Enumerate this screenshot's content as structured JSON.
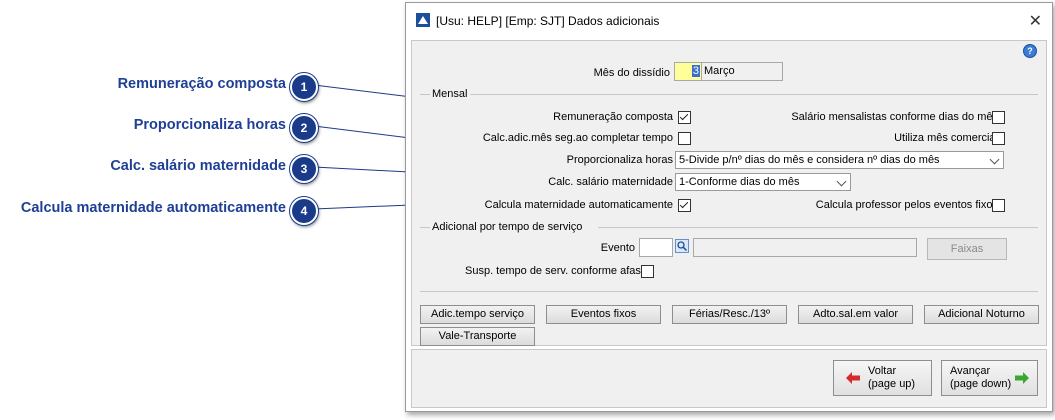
{
  "callouts": [
    {
      "label": "Remuneração composta",
      "number": "1"
    },
    {
      "label": "Proporcionaliza horas",
      "number": "2"
    },
    {
      "label": "Calc. salário maternidade",
      "number": "3"
    },
    {
      "label": "Calcula maternidade automaticamente",
      "number": "4"
    }
  ],
  "window": {
    "title": "[Usu: HELP] [Emp: SJT] Dados adicionais",
    "help_icon": "?"
  },
  "dissidio": {
    "label": "Mês do dissídio",
    "value": "3",
    "month_name": "Março"
  },
  "mensal": {
    "group_label": "Mensal",
    "remuneracao_composta": {
      "label": "Remuneração composta",
      "checked": true
    },
    "calc_adic_mes": {
      "label": "Calc.adic.mês seg.ao completar tempo",
      "checked": false
    },
    "proporcionaliza_horas": {
      "label": "Proporcionaliza horas",
      "value": "5-Divide p/nº dias do mês e considera nº dias do mês"
    },
    "calc_salario_maternidade": {
      "label": "Calc. salário maternidade",
      "value": "1-Conforme dias do mês"
    },
    "calcula_maternidade_auto": {
      "label": "Calcula maternidade automaticamente",
      "checked": true
    },
    "salario_mensalistas": {
      "label": "Salário mensalistas conforme dias do mês",
      "checked": false
    },
    "utiliza_mes_comercial": {
      "label": "Utiliza mês comercial",
      "checked": false
    },
    "calcula_professor": {
      "label": "Calcula professor pelos eventos fixos",
      "checked": false
    }
  },
  "adicional": {
    "group_label": "Adicional por tempo de serviço",
    "evento_label": "Evento",
    "evento_value": "",
    "faixas_button": "Faixas",
    "susp_label": "Susp. tempo de serv. conforme afast.",
    "susp_checked": false
  },
  "buttons": {
    "adic_tempo_servico": "Adic.tempo serviço",
    "eventos_fixos": "Eventos fixos",
    "ferias": "Férias/Resc./13º",
    "adto_sal": "Adto.sal.em valor",
    "adicional_noturno": "Adicional Noturno",
    "vale_transporte": "Vale-Transporte"
  },
  "nav": {
    "voltar": "Voltar",
    "voltar_hint": "(page up)",
    "avancar": "Avançar",
    "avancar_hint": "(page down)"
  },
  "colors": {
    "callout_badge": "#1a3a8a",
    "callout_text": "#1f3f95",
    "highlight_input": "#ffff99",
    "arrow_back": "#d42c2c",
    "arrow_forward": "#3aa82e"
  }
}
